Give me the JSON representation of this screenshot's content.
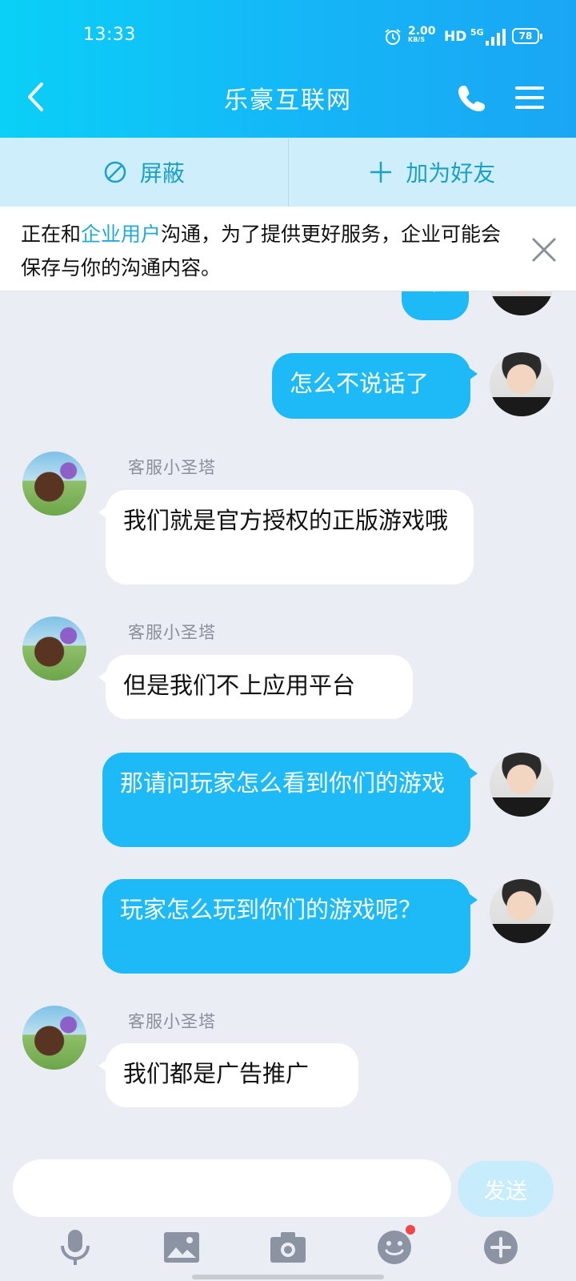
{
  "status_bar": {
    "time": "13:33",
    "speed_value": "2.00",
    "speed_unit": "KB/S",
    "hd": "HD",
    "network": "5G",
    "battery": "78"
  },
  "header": {
    "title": "乐豪互联网"
  },
  "actions": {
    "block_label": "屏蔽",
    "add_friend_label": "加为好友"
  },
  "notice": {
    "prefix": "正在和",
    "highlight": "企业用户",
    "suffix": "沟通，为了提供更好服务，企业可能会保存与你的沟通内容。"
  },
  "messages": [
    {
      "side": "out",
      "text": "?"
    },
    {
      "side": "out",
      "text": "怎么不说话了"
    },
    {
      "side": "in",
      "sender": "客服小圣塔",
      "text": "我们就是官方授权的正版游戏哦"
    },
    {
      "side": "in",
      "sender": "客服小圣塔",
      "text": "但是我们不上应用平台"
    },
    {
      "side": "out",
      "text": "那请问玩家怎么看到你们的游戏"
    },
    {
      "side": "out",
      "text": "玩家怎么玩到你们的游戏呢？"
    },
    {
      "side": "in",
      "sender": "客服小圣塔",
      "text": "我们都是广告推广"
    }
  ],
  "input": {
    "placeholder": "",
    "send_label": "发送"
  },
  "colors": {
    "header_start": "#0ad0f7",
    "header_end": "#1aa6f4",
    "outgoing_bubble": "#1ebaf8",
    "incoming_bubble": "#ffffff",
    "background": "#eaedf4",
    "accent_text": "#20a9db",
    "notification_dot": "#f04747"
  },
  "icons": {
    "back": "back-icon",
    "call": "phone-icon",
    "menu": "menu-icon",
    "block": "block-icon",
    "add": "plus-icon",
    "close": "close-icon",
    "toolbar": [
      "microphone-icon",
      "image-icon",
      "camera-icon",
      "emoji-icon",
      "plus-circle-icon"
    ]
  }
}
